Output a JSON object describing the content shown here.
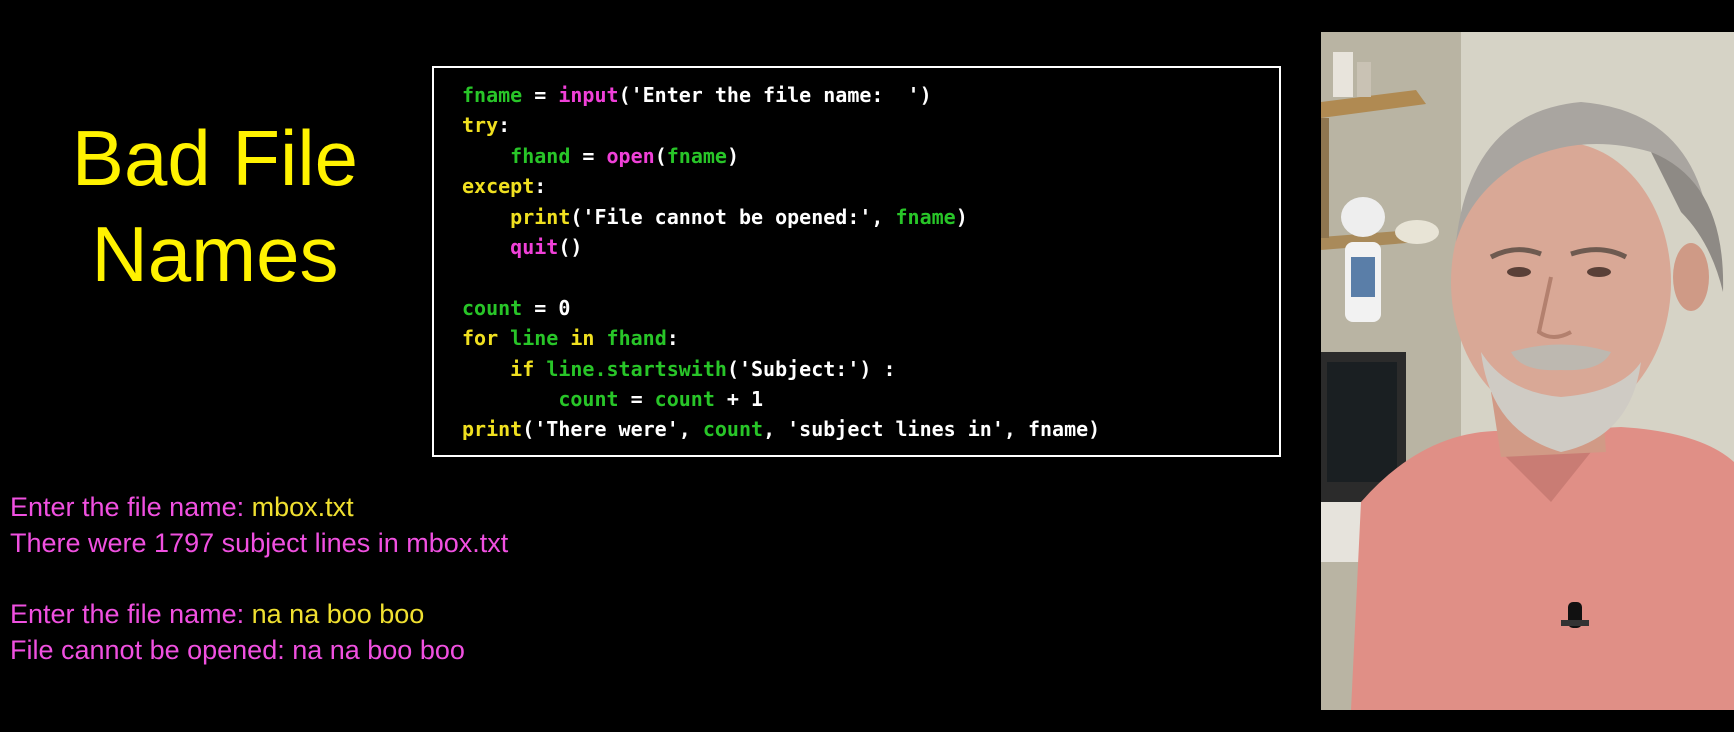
{
  "slide": {
    "title_line1": "Bad File",
    "title_line2": "Names"
  },
  "code": {
    "lines": [
      [
        [
          "name",
          "fname"
        ],
        [
          "plain",
          " = "
        ],
        [
          "func",
          "input"
        ],
        [
          "plain",
          "('Enter the file name:  ')"
        ]
      ],
      [
        [
          "key",
          "try"
        ],
        [
          "plain",
          ":"
        ]
      ],
      [
        [
          "plain",
          "    "
        ],
        [
          "name",
          "fhand"
        ],
        [
          "plain",
          " = "
        ],
        [
          "func",
          "open"
        ],
        [
          "plain",
          "("
        ],
        [
          "name",
          "fname"
        ],
        [
          "plain",
          ")"
        ]
      ],
      [
        [
          "key",
          "except"
        ],
        [
          "plain",
          ":"
        ]
      ],
      [
        [
          "plain",
          "    "
        ],
        [
          "key",
          "print"
        ],
        [
          "plain",
          "('File cannot be opened:', "
        ],
        [
          "name",
          "fname"
        ],
        [
          "plain",
          ")"
        ]
      ],
      [
        [
          "plain",
          "    "
        ],
        [
          "func",
          "quit"
        ],
        [
          "plain",
          "()"
        ]
      ],
      [],
      [
        [
          "name",
          "count"
        ],
        [
          "plain",
          " = 0"
        ]
      ],
      [
        [
          "key",
          "for"
        ],
        [
          "plain",
          " "
        ],
        [
          "name",
          "line"
        ],
        [
          "plain",
          " "
        ],
        [
          "key",
          "in"
        ],
        [
          "plain",
          " "
        ],
        [
          "name",
          "fhand"
        ],
        [
          "plain",
          ":"
        ]
      ],
      [
        [
          "plain",
          "    "
        ],
        [
          "key",
          "if"
        ],
        [
          "plain",
          " "
        ],
        [
          "name",
          "line.startswith"
        ],
        [
          "plain",
          "('Subject:') :"
        ]
      ],
      [
        [
          "plain",
          "        "
        ],
        [
          "name",
          "count"
        ],
        [
          "plain",
          " = "
        ],
        [
          "name",
          "count"
        ],
        [
          "plain",
          " + 1"
        ]
      ],
      [
        [
          "key",
          "print"
        ],
        [
          "plain",
          "('There were', "
        ],
        [
          "name",
          "count"
        ],
        [
          "plain",
          ", 'subject lines in', fname)"
        ]
      ]
    ]
  },
  "console": {
    "run1": {
      "prompt": "Enter the file name: ",
      "input": "mbox.txt",
      "output": "There were 1797 subject lines in mbox.txt"
    },
    "run2": {
      "prompt": "Enter the file name: ",
      "input": "na na boo boo",
      "output": "File cannot be opened: na na boo boo"
    }
  },
  "colors": {
    "title": "#fff200",
    "code_variable": "#28c528",
    "code_keyword": "#f0e020",
    "code_function": "#f040d8",
    "console_prompt": "#f050e0",
    "console_input": "#f0e030"
  }
}
